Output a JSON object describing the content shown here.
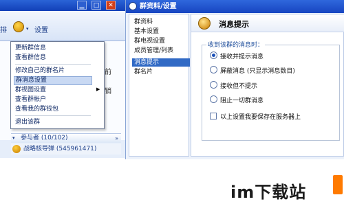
{
  "left_window": {
    "title_buttons": [
      "▁",
      "□",
      "✕"
    ],
    "toolbar_left_text": "排",
    "toolbar_settings_label": "设置",
    "side_text_1": "前",
    "side_text_2": "销",
    "members_header": "参与者 (10/102)",
    "member_line": "战略核导弹 (545961471)"
  },
  "context_menu": {
    "items": [
      {
        "label": "更新群信息"
      },
      {
        "label": "查看群信息"
      },
      {
        "label": "修改自己的群名片"
      },
      {
        "label": "群消息设置",
        "active": true
      },
      {
        "label": "群视图设置",
        "submenu": true
      },
      {
        "label": "查看群帐户"
      },
      {
        "label": "查看我的群钱包"
      },
      {
        "label": "退出该群"
      }
    ]
  },
  "settings_window": {
    "title": "群资料/设置",
    "nav_items": [
      {
        "label": "群资料"
      },
      {
        "label": "基本设置"
      },
      {
        "label": "群电视设置"
      },
      {
        "label": "成员管理/列表"
      },
      {
        "label": "消息提示",
        "active": true
      },
      {
        "label": "群名片"
      }
    ],
    "section_title": "消息提示",
    "group_legend": "收到该群的消息时：",
    "options": [
      {
        "label": "接收并提示消息",
        "checked": true
      },
      {
        "label": "屏蔽消息 (只显示消息数目)",
        "checked": false
      },
      {
        "label": "接收但不提示",
        "checked": false
      },
      {
        "label": "阻止一切群消息",
        "checked": false
      }
    ],
    "save_to_server_label": "以上设置我要保存在服务器上"
  },
  "watermark": "im下载站",
  "colors": {
    "title_bar": "#1f55cc",
    "nav_active": "#316ac5",
    "menu_highlight": "#c9d9f3"
  }
}
